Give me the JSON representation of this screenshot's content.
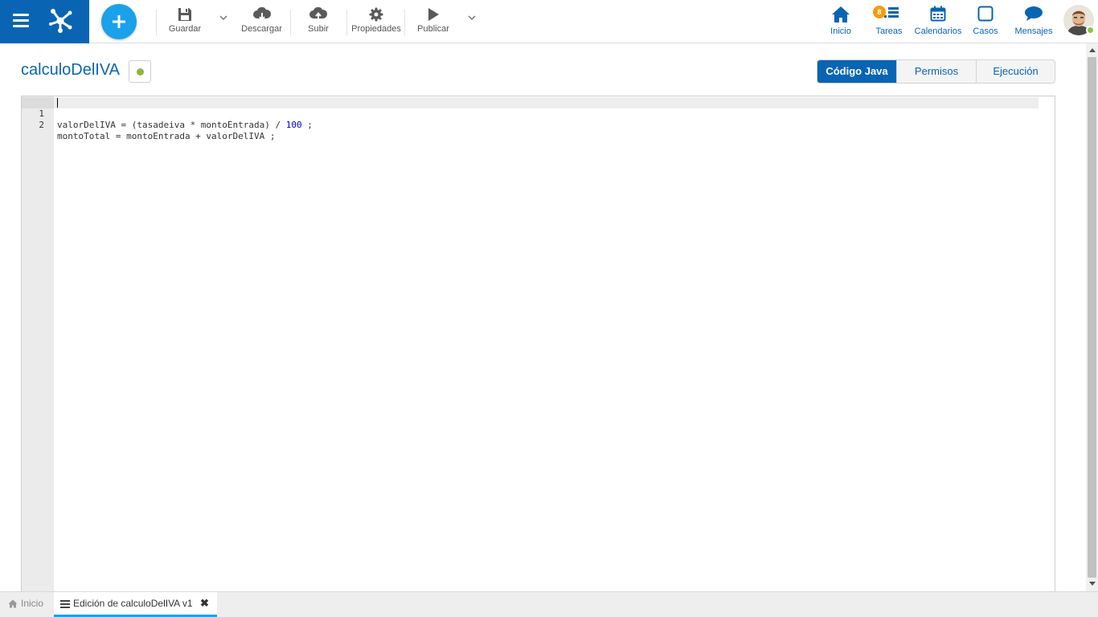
{
  "toolbar": {
    "save_label": "Guardar",
    "download_label": "Descargar",
    "upload_label": "Subir",
    "properties_label": "Propiedades",
    "publish_label": "Publicar"
  },
  "nav": {
    "home_label": "Inicio",
    "tasks_label": "Tareas",
    "tasks_badge": "8",
    "calendars_label": "Calendarios",
    "cases_label": "Casos",
    "messages_label": "Mensajes"
  },
  "page": {
    "title": "calculoDelIVA",
    "status_color": "#8cb83c"
  },
  "tabs": [
    {
      "label": "Código Java",
      "active": true
    },
    {
      "label": "Permisos",
      "active": false
    },
    {
      "label": "Ejecución",
      "active": false
    }
  ],
  "editor": {
    "lines": [
      {
        "num": "1",
        "before": "valorDelIVA = (tasadeiva * montoEntrada) / ",
        "number": "100",
        "after": " ;"
      },
      {
        "num": "2",
        "text": "montoTotal = montoEntrada + valorDelIVA ;"
      }
    ]
  },
  "bottom_tabs": {
    "home_label": "Inicio",
    "edit_label": "Edición de calculoDelIVA v1",
    "close_symbol": "✖"
  },
  "colors": {
    "brand": "#0a64b4",
    "accent": "#1aa1ea",
    "badge": "#f39c12",
    "online": "#8cc63f"
  }
}
